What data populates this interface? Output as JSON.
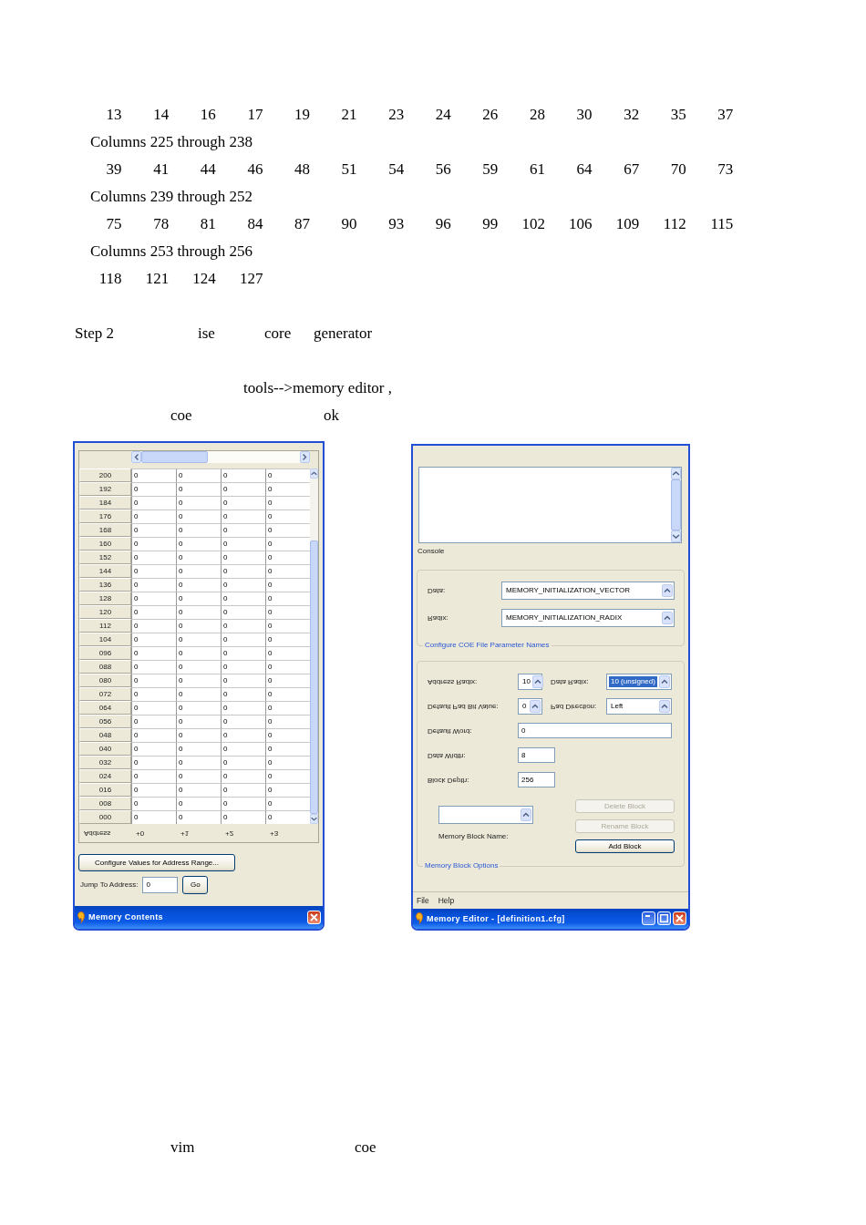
{
  "matrix_output": {
    "lines": [
      {
        "kind": "values",
        "values": [
          "13",
          "14",
          "16",
          "17",
          "19",
          "21",
          "23",
          "24",
          "26",
          "28",
          "30",
          "32",
          "35",
          "37"
        ]
      },
      {
        "kind": "heading",
        "text": "Columns 225 through 238"
      },
      {
        "kind": "values",
        "values": [
          "39",
          "41",
          "44",
          "46",
          "48",
          "51",
          "54",
          "56",
          "59",
          "61",
          "64",
          "67",
          "70",
          "73"
        ]
      },
      {
        "kind": "heading",
        "text": "Columns 239 through 252"
      },
      {
        "kind": "values",
        "values": [
          "75",
          "78",
          "81",
          "84",
          "87",
          "90",
          "93",
          "96",
          "99",
          "102",
          "106",
          "109",
          "112",
          "115"
        ]
      },
      {
        "kind": "heading",
        "text": "Columns 253 through 256"
      },
      {
        "kind": "values",
        "values": [
          "118",
          "121",
          "124",
          "127"
        ]
      }
    ]
  },
  "step_heading": {
    "segments": [
      "Step 2",
      "ise",
      "core",
      "generator"
    ]
  },
  "instructions": {
    "lines": [
      {
        "segments": [
          "tools-->memory editor ,"
        ]
      },
      {
        "segments": [
          "coe",
          "ok"
        ]
      }
    ]
  },
  "memory_contents_window": {
    "title": "Memory Contents",
    "jump_to_address": {
      "label": "Jump To Address:",
      "value": "0",
      "button": "Go"
    },
    "configure_button": "Configure Values for Address Range...",
    "table": {
      "columns": [
        "Address",
        "+0",
        "+1",
        "+2",
        "+3"
      ],
      "rows": [
        {
          "address": "200",
          "values": [
            "0",
            "0",
            "0",
            "0"
          ]
        },
        {
          "address": "192",
          "values": [
            "0",
            "0",
            "0",
            "0"
          ]
        },
        {
          "address": "184",
          "values": [
            "0",
            "0",
            "0",
            "0"
          ]
        },
        {
          "address": "176",
          "values": [
            "0",
            "0",
            "0",
            "0"
          ]
        },
        {
          "address": "168",
          "values": [
            "0",
            "0",
            "0",
            "0"
          ]
        },
        {
          "address": "160",
          "values": [
            "0",
            "0",
            "0",
            "0"
          ]
        },
        {
          "address": "152",
          "values": [
            "0",
            "0",
            "0",
            "0"
          ]
        },
        {
          "address": "144",
          "values": [
            "0",
            "0",
            "0",
            "0"
          ]
        },
        {
          "address": "136",
          "values": [
            "0",
            "0",
            "0",
            "0"
          ]
        },
        {
          "address": "128",
          "values": [
            "0",
            "0",
            "0",
            "0"
          ]
        },
        {
          "address": "120",
          "values": [
            "0",
            "0",
            "0",
            "0"
          ]
        },
        {
          "address": "112",
          "values": [
            "0",
            "0",
            "0",
            "0"
          ]
        },
        {
          "address": "104",
          "values": [
            "0",
            "0",
            "0",
            "0"
          ]
        },
        {
          "address": "096",
          "values": [
            "0",
            "0",
            "0",
            "0"
          ]
        },
        {
          "address": "088",
          "values": [
            "0",
            "0",
            "0",
            "0"
          ]
        },
        {
          "address": "080",
          "values": [
            "0",
            "0",
            "0",
            "0"
          ]
        },
        {
          "address": "072",
          "values": [
            "0",
            "0",
            "0",
            "0"
          ]
        },
        {
          "address": "064",
          "values": [
            "0",
            "0",
            "0",
            "0"
          ]
        },
        {
          "address": "056",
          "values": [
            "0",
            "0",
            "0",
            "0"
          ]
        },
        {
          "address": "048",
          "values": [
            "0",
            "0",
            "0",
            "0"
          ]
        },
        {
          "address": "040",
          "values": [
            "0",
            "0",
            "0",
            "0"
          ]
        },
        {
          "address": "032",
          "values": [
            "0",
            "0",
            "0",
            "0"
          ]
        },
        {
          "address": "024",
          "values": [
            "0",
            "0",
            "0",
            "0"
          ]
        },
        {
          "address": "016",
          "values": [
            "0",
            "0",
            "0",
            "0"
          ]
        },
        {
          "address": "008",
          "values": [
            "0",
            "0",
            "0",
            "0"
          ]
        },
        {
          "address": "000",
          "values": [
            "0",
            "0",
            "0",
            "0"
          ]
        }
      ]
    }
  },
  "memory_editor_window": {
    "title": "Memory Editor - [definition1.cfg]",
    "menu": [
      "File",
      "Help"
    ],
    "memory_block_options": {
      "legend": "Memory Block Options",
      "block_name": {
        "label": "Memory Block Name:"
      },
      "buttons": [
        {
          "label": "Delete Block",
          "disabled": true
        },
        {
          "label": "Rename Block",
          "disabled": true
        },
        {
          "label": "Add Block",
          "disabled": false
        }
      ],
      "block_depth": {
        "label": "Block Depth:",
        "value": "256"
      },
      "data_width": {
        "label": "Data Width:",
        "value": "8"
      },
      "default_word": {
        "label": "Default Word:",
        "value": "0"
      },
      "default_pad_bit_value": {
        "label": "Default Pad Bit Value:",
        "value": "0"
      },
      "pad_direction": {
        "label": "Pad Direction:",
        "value": "Left"
      },
      "address_radix": {
        "label": "Address Radix:",
        "value": "10"
      },
      "data_radix": {
        "label": "Data Radix:",
        "value": "10 (unsigned)",
        "focused": true
      }
    },
    "coe_parameter_names": {
      "legend": "Configure COE File Parameter Names",
      "radix": {
        "label": "Radix:",
        "value": "MEMORY_INITIALIZATION_RADIX"
      },
      "data": {
        "label": "Data:",
        "value": "MEMORY_INITIALIZATION_VECTOR"
      }
    },
    "console": {
      "label": "Console"
    }
  },
  "closing_note": {
    "segments": [
      "vim",
      "coe"
    ]
  }
}
